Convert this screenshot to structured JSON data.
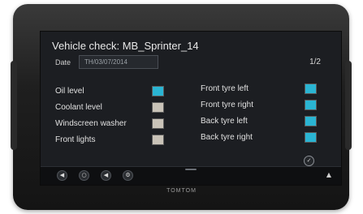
{
  "screen": {
    "title": "Vehicle check: MB_Sprinter_14",
    "page_indicator": "1/2",
    "date": {
      "label": "Date",
      "value": "TH/03/07/2014"
    }
  },
  "checks_left": [
    {
      "label": "Oil level",
      "color": "#2ab5d3"
    },
    {
      "label": "Coolant level",
      "color": "#c9c3b8"
    },
    {
      "label": "Windscreen washer",
      "color": "#c9c3b8"
    },
    {
      "label": "Front lights",
      "color": "#c9c3b8"
    }
  ],
  "checks_right": [
    {
      "label": "Front tyre left",
      "color": "#2ab5d3"
    },
    {
      "label": "Front tyre right",
      "color": "#2ab5d3"
    },
    {
      "label": "Back tyre left",
      "color": "#2ab5d3"
    },
    {
      "label": "Back tyre right",
      "color": "#2ab5d3"
    }
  ],
  "confirm_button": {
    "icon": "checkmark-icon",
    "glyph": "✓"
  },
  "nav_bar": {
    "buttons": [
      {
        "name": "back-icon",
        "glyph": "◀"
      },
      {
        "name": "home-icon",
        "glyph": "○"
      },
      {
        "name": "volume-icon",
        "glyph": "◀"
      },
      {
        "name": "settings-icon",
        "glyph": "⚙"
      }
    ],
    "up_glyph": "▲"
  },
  "device": {
    "brand": "TOMTOM"
  }
}
